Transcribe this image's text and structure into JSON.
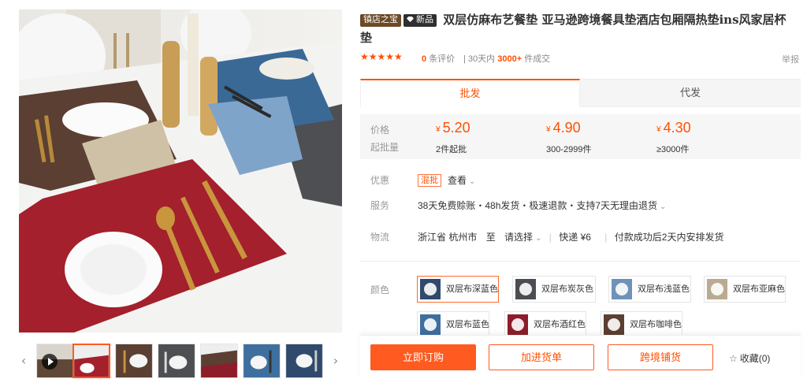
{
  "product": {
    "badges": {
      "treasure": "镇店之宝",
      "new": "新品"
    },
    "title": "双层仿麻布艺餐垫 亚马逊跨境餐具垫酒店包厢隔热垫ins风家居杯垫",
    "rating": {
      "stars": "★★★★★",
      "review_count": "0",
      "review_suffix": "条评价",
      "sales_prefix": "30天内",
      "sales_value": "3000+",
      "sales_suffix": "件成交"
    },
    "report_link": "举报"
  },
  "tabs": [
    {
      "label": "批发"
    },
    {
      "label": "代发"
    }
  ],
  "pricing": {
    "price_label": "价格",
    "moq_label": "起批量",
    "currency": "¥",
    "tiers": [
      {
        "price": "5.20",
        "qty": "2件起批"
      },
      {
        "price": "4.90",
        "qty": "300-2999件"
      },
      {
        "price": "4.30",
        "qty": "≥3000件"
      }
    ]
  },
  "promotion": {
    "label": "优惠",
    "tag": "混批",
    "link": "查看"
  },
  "service": {
    "label": "服务",
    "text": "38天免费赊账・48h发货・极速退款・支持7天无理由退货"
  },
  "logistics": {
    "label": "物流",
    "from": "浙江省 杭州市",
    "to_word": "至",
    "destination": "请选择",
    "shipping": "快递 ¥6",
    "note": "付款成功后2天内安排发货"
  },
  "colors": {
    "label": "颜色",
    "options": [
      {
        "name": "双层布深蓝色",
        "swatch": "#2f4a6c"
      },
      {
        "name": "双层布炭灰色",
        "swatch": "#4a4d52"
      },
      {
        "name": "双层布浅蓝色",
        "swatch": "#6f93b8"
      },
      {
        "name": "双层布亚麻色",
        "swatch": "#b9ab92"
      },
      {
        "name": "双层布蓝色",
        "swatch": "#3f6f9f"
      },
      {
        "name": "双层布酒红色",
        "swatch": "#8e1c2a"
      },
      {
        "name": "双层布咖啡色",
        "swatch": "#5b3f30"
      }
    ]
  },
  "actions": {
    "buy": "立即订购",
    "cart": "加进货单",
    "cross": "跨境铺货",
    "favorite": "收藏(0)"
  },
  "accent_color": "#ff5000"
}
